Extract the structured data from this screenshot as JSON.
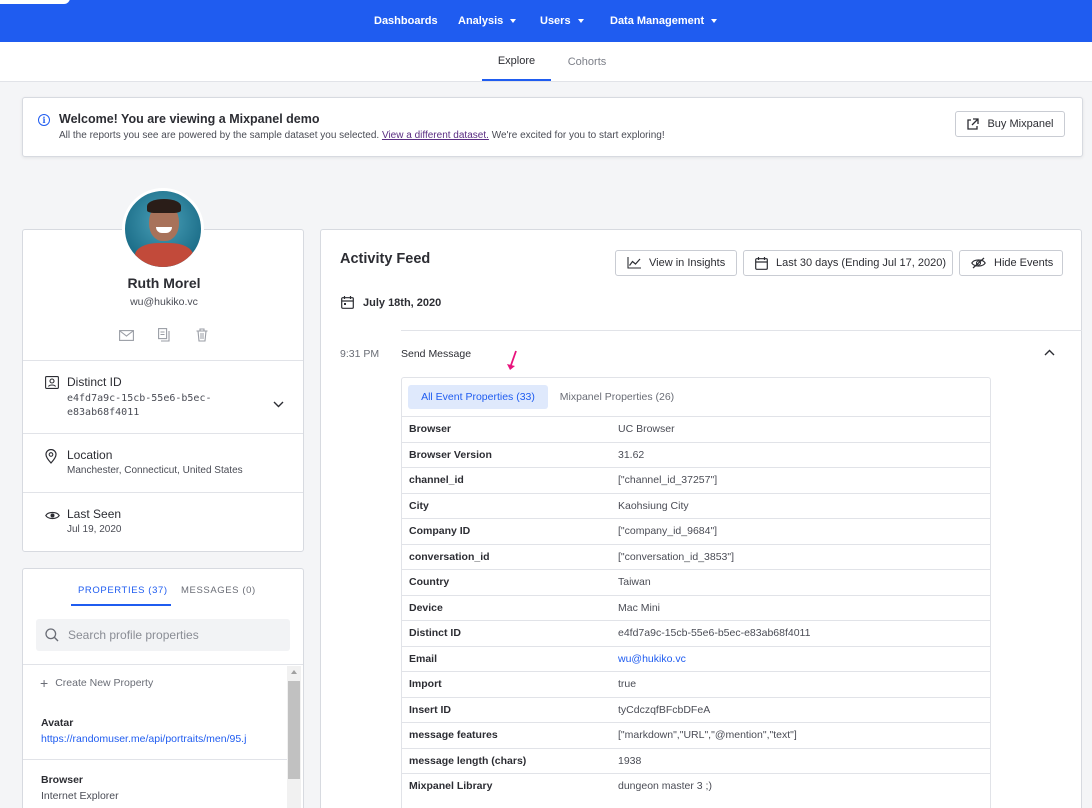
{
  "topnav": {
    "items": [
      {
        "label": "Dashboards",
        "dropdown": false
      },
      {
        "label": "Analysis",
        "dropdown": true
      },
      {
        "label": "Users",
        "dropdown": true
      },
      {
        "label": "Data Management",
        "dropdown": true
      }
    ]
  },
  "subnav": {
    "tabs": [
      {
        "label": "Explore",
        "active": true
      },
      {
        "label": "Cohorts",
        "active": false
      }
    ]
  },
  "banner": {
    "title": "Welcome! You are viewing a Mixpanel demo",
    "desc_before": "All the reports you see are powered by the sample dataset you selected.",
    "desc_link": "View a different dataset.",
    "desc_after": "We're excited for you to start exploring!",
    "buy_label": "Buy Mixpanel"
  },
  "profile": {
    "name": "Ruth Morel",
    "email": "wu@hukiko.vc",
    "distinct_id": {
      "label": "Distinct ID",
      "value_line1": "e4fd7a9c-15cb-55e6-b5ec-",
      "value_line2": "e83ab68f4011"
    },
    "location": {
      "label": "Location",
      "value": "Manchester, Connecticut, United States"
    },
    "last_seen": {
      "label": "Last Seen",
      "value": "Jul 19, 2020"
    }
  },
  "properties_panel": {
    "tab_properties": "PROPERTIES (37)",
    "tab_messages": "MESSAGES (0)",
    "search_placeholder": "Search profile properties",
    "create_label": "Create New Property",
    "items": [
      {
        "key": "Avatar",
        "value": "https://randomuser.me/api/portraits/men/95.j"
      },
      {
        "key": "Browser",
        "value": "Internet Explorer"
      }
    ]
  },
  "feed": {
    "title": "Activity Feed",
    "view_insights_label": "View in Insights",
    "date_range_label": "Last 30 days (Ending Jul 17, 2020)",
    "hide_events_label": "Hide Events",
    "date_heading": "July 18th, 2020",
    "event": {
      "time": "9:31 PM",
      "name": "Send Message",
      "tab_all": "All Event Properties (33)",
      "tab_mixpanel": "Mixpanel Properties (26)",
      "rows": [
        {
          "key": "Browser",
          "value": "UC Browser"
        },
        {
          "key": "Browser Version",
          "value": "31.62"
        },
        {
          "key": "channel_id",
          "value": "[\"channel_id_37257\"]"
        },
        {
          "key": "City",
          "value": "Kaohsiung City"
        },
        {
          "key": "Company ID",
          "value": "[\"company_id_9684\"]"
        },
        {
          "key": "conversation_id",
          "value": "[\"conversation_id_3853\"]"
        },
        {
          "key": "Country",
          "value": "Taiwan"
        },
        {
          "key": "Device",
          "value": "Mac Mini"
        },
        {
          "key": "Distinct ID",
          "value": "e4fd7a9c-15cb-55e6-b5ec-e83ab68f4011"
        },
        {
          "key": "Email",
          "value": "wu@hukiko.vc"
        },
        {
          "key": "Import",
          "value": "true"
        },
        {
          "key": "Insert ID",
          "value": "tyCdczqfBFcbDFeA"
        },
        {
          "key": "message features",
          "value": "[\"markdown\",\"URL\",\"@mention\",\"text\"]"
        },
        {
          "key": "message length (chars)",
          "value": "1938"
        },
        {
          "key": "Mixpanel Library",
          "value": "dungeon master 3 ;)"
        }
      ]
    }
  },
  "colors": {
    "brand": "#1f5cf0",
    "annotation_arrow": "#e8127c"
  }
}
